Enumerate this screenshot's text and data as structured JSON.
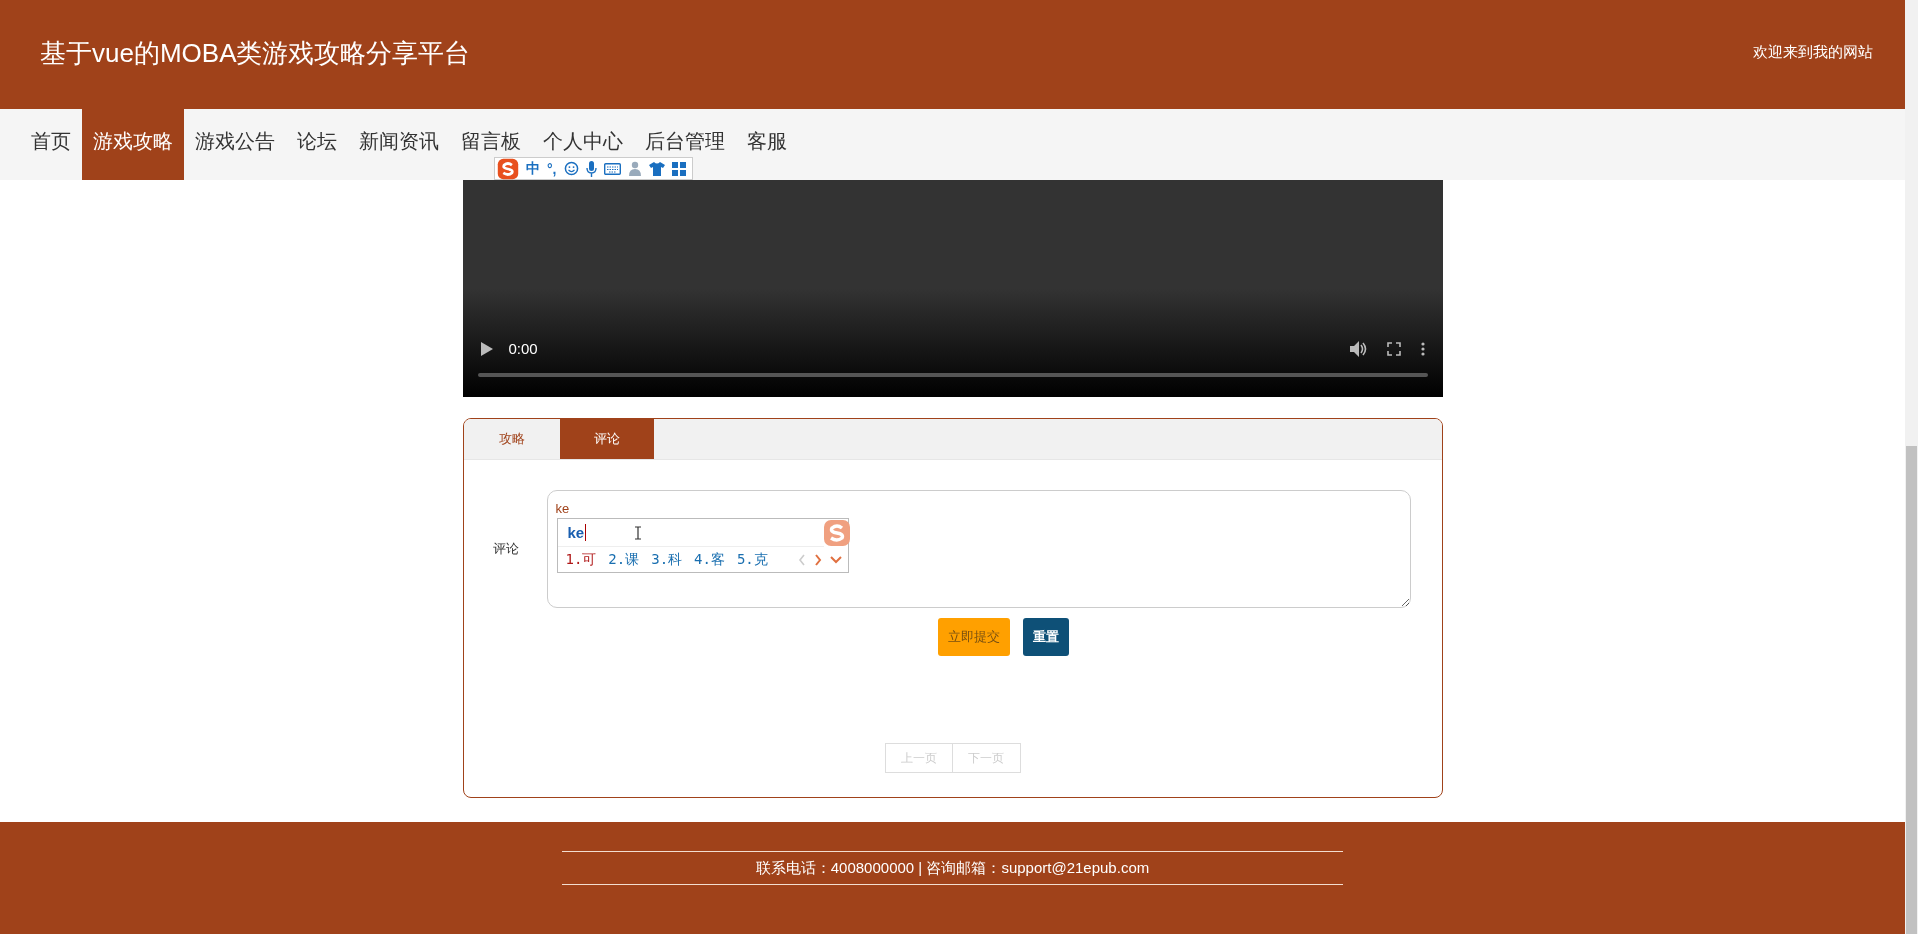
{
  "header": {
    "title": "基于vue的MOBA类游戏攻略分享平台",
    "welcome": "欢迎来到我的网站"
  },
  "nav": [
    {
      "label": "首页",
      "selected": false
    },
    {
      "label": "游戏攻略",
      "selected": true
    },
    {
      "label": "游戏公告",
      "selected": false
    },
    {
      "label": "论坛",
      "selected": false
    },
    {
      "label": "新闻资讯",
      "selected": false
    },
    {
      "label": "留言板",
      "selected": false
    },
    {
      "label": "个人中心",
      "selected": false
    },
    {
      "label": "后台管理",
      "selected": false
    },
    {
      "label": "客服",
      "selected": false
    }
  ],
  "ime_toolbar": {
    "mode": "中",
    "punctuation": "°,"
  },
  "video": {
    "time": "0:00"
  },
  "tabs": [
    {
      "label": "攻略",
      "selected": false
    },
    {
      "label": "评论",
      "selected": true
    }
  ],
  "comment_form": {
    "label": "评论",
    "value": "ke",
    "buttons": [
      {
        "label": "立即提交",
        "kind": "submit"
      },
      {
        "label": "重置",
        "kind": "reset"
      }
    ]
  },
  "ime_candidates": {
    "composition": "ke",
    "candidates": [
      {
        "label": "1.可",
        "selected": true
      },
      {
        "label": "2.课",
        "selected": false
      },
      {
        "label": "3.科",
        "selected": false
      },
      {
        "label": "4.客",
        "selected": false
      },
      {
        "label": "5.克",
        "selected": false
      }
    ]
  },
  "pagination": [
    {
      "label": "上一页",
      "disabled": true
    },
    {
      "label": "下一页",
      "disabled": true
    }
  ],
  "footer": {
    "contact": "联系电话：4008000000 | 咨询邮箱：support@21epub.com"
  }
}
